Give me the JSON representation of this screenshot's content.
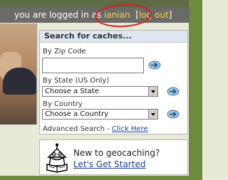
{
  "topbar": {
    "prefix": "you are logged in as",
    "username": "ianian",
    "open_bracket": "[",
    "logout": "log out",
    "close_bracket": "]"
  },
  "search": {
    "title": "Search for caches...",
    "zip_label": "By Zip Code",
    "zip_value": "",
    "state_label": "By State (US Only)",
    "state_selected": "Choose a State",
    "country_label": "By Country",
    "country_selected": "Choose a Country",
    "advanced_prefix": "Advanced Search -",
    "advanced_link": "Click Here"
  },
  "newcomer": {
    "title": "New to geocaching?",
    "link": "Let's Get Started"
  },
  "colors": {
    "topbar_bg": "#6a6a66",
    "username": "#ffd23a",
    "link": "#1a3f9c",
    "annotation_circle": "#d82020"
  },
  "icons": [
    "go-arrow-icon",
    "mascot-icon"
  ]
}
